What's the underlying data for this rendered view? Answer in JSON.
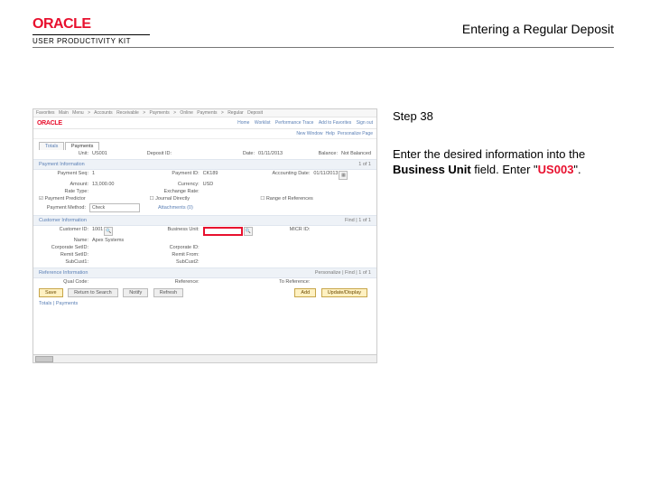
{
  "brand": {
    "logo": "ORACLE",
    "subtitle": "USER PRODUCTIVITY KIT"
  },
  "page_title": "Entering a Regular Deposit",
  "instructions": {
    "step_label": "Step 38",
    "line1": "Enter the desired information into the ",
    "bold_field": "Business Unit",
    "line2": " field. Enter \"",
    "red_value": "US003",
    "line3": "\"."
  },
  "app": {
    "menubar": "Favorites  Main Menu > Accounts Receivable > Payments > Online Payments > Regular Deposit",
    "brand_logo": "ORACLE",
    "top_links": [
      "Home",
      "Worklist",
      "Performance Trace",
      "Add to Favorites",
      "Sign out"
    ],
    "subnav": [
      "New Window",
      "Help",
      "Personalize Page"
    ],
    "tabs": [
      "Totals",
      "Payments"
    ],
    "row_top": {
      "unit_lbl": "Unit:",
      "unit_val": "US001",
      "dep_lbl": "Deposit ID:",
      "dep_val": "",
      "date_lbl": "Date:",
      "date_val": "01/11/2013",
      "bal_lbl": "Balance:",
      "bal_val": "Not Balanced"
    },
    "section_payment_info": "Payment Information",
    "pi": {
      "payseq_lbl": "Payment Seq:",
      "payseq_val": "1",
      "payid_lbl": "Payment ID:",
      "payid_val": "CK189",
      "acct_lbl": "Accounting Date:",
      "acct_val": "01/11/2013",
      "amount_lbl": "Amount:",
      "amount_val": "13,000.00",
      "currency_lbl": "Currency:",
      "currency_val": "USD",
      "rate_lbl": "Rate Type:",
      "exch_lbl": "Exchange Rate:",
      "pp_lbl": "Payment Predictor",
      "jd_lbl": "Journal Directly",
      "ror_lbl": "Range of References"
    },
    "method_lbl": "Payment Method:",
    "method_val": "Check",
    "attach_lbl": "Attachments (0)",
    "section_customer_info": "Customer Information",
    "ci": {
      "custid_lbl": "Customer ID:",
      "custid_val": "1001",
      "bu_lbl": "Business Unit:",
      "mrcr_lbl": "MICR ID:",
      "link_lbl": "Corporate SetID:",
      "remit_lbl": "Remit SetID:",
      "name_lbl": "Name:",
      "name_val": "Apex Systems",
      "corpid_lbl": "Corporate ID:",
      "remitid_lbl": "Remit From:",
      "subcust1_lbl": "SubCust1:",
      "subcust2_lbl": "SubCust2:"
    },
    "section_ref_info": "Reference Information",
    "ri": {
      "qual_lbl": "Qual Code:",
      "ref_lbl": "Reference:",
      "to_lbl": "To Reference:"
    },
    "buttons": {
      "save": "Save",
      "return": "Return to Search",
      "notify": "Notify",
      "refresh": "Refresh",
      "add": "Add",
      "update": "Update/Display"
    },
    "footer_tabs": "Totals | Payments"
  }
}
